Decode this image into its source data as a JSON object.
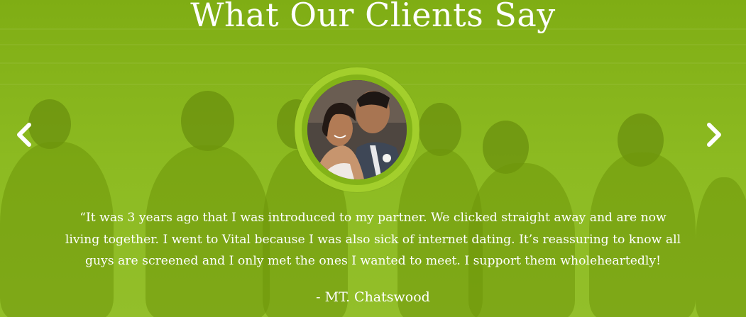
{
  "testimonials": {
    "title": "What Our Clients Say",
    "prev_icon": "chevron-left-icon",
    "next_icon": "chevron-right-icon",
    "avatar_description": "couple-photo",
    "quote": "“It was 3 years ago that I was introduced to my partner. We clicked straight away and are now living together. I went to Vital because I was also sick of internet dating. It’s reassuring to know all guys are screened and I only met the ones I wanted to meet.  I support them wholeheartedly!",
    "author": "- MT. Chatswood"
  },
  "colors": {
    "background": "#8dba21",
    "ring_outer": "#a3cf2c",
    "ring_inner": "#83b318",
    "text": "#ffffff"
  }
}
